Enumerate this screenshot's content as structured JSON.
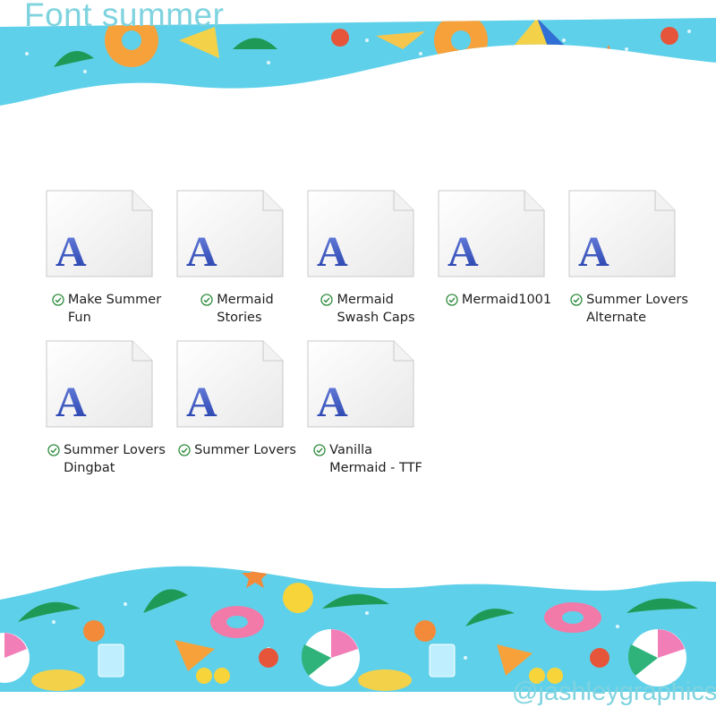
{
  "header": {
    "title": "Font summer"
  },
  "footer": {
    "credit": "@jashleygraphics"
  },
  "files": [
    {
      "line1": "Make Summer",
      "line2": "Fun",
      "status_icon": "check-circle-icon",
      "file_icon": "font-file-icon"
    },
    {
      "line1": "Mermaid",
      "line2": "Stories",
      "status_icon": "check-circle-icon",
      "file_icon": "font-file-icon"
    },
    {
      "line1": "Mermaid",
      "line2": "Swash Caps",
      "status_icon": "check-circle-icon",
      "file_icon": "font-file-icon"
    },
    {
      "line1": "Mermaid1001",
      "line2": "",
      "status_icon": "check-circle-icon",
      "file_icon": "font-file-icon"
    },
    {
      "line1": "Summer Lovers",
      "line2": "Alternate",
      "status_icon": "check-circle-icon",
      "file_icon": "font-file-icon"
    },
    {
      "line1": "Summer Lovers",
      "line2": "Dingbat",
      "status_icon": "check-circle-icon",
      "file_icon": "font-file-icon"
    },
    {
      "line1": "Summer Lovers",
      "line2": "",
      "status_icon": "check-circle-icon",
      "file_icon": "font-file-icon"
    },
    {
      "line1": "Vanilla",
      "line2": "Mermaid - TTF",
      "status_icon": "check-circle-icon",
      "file_icon": "font-file-icon"
    }
  ],
  "colors": {
    "banner_sky": "#5fd0ea",
    "title_text": "#7fd3df",
    "font_glyph": "#2b47b8",
    "sync_check": "#2e8b3c"
  }
}
